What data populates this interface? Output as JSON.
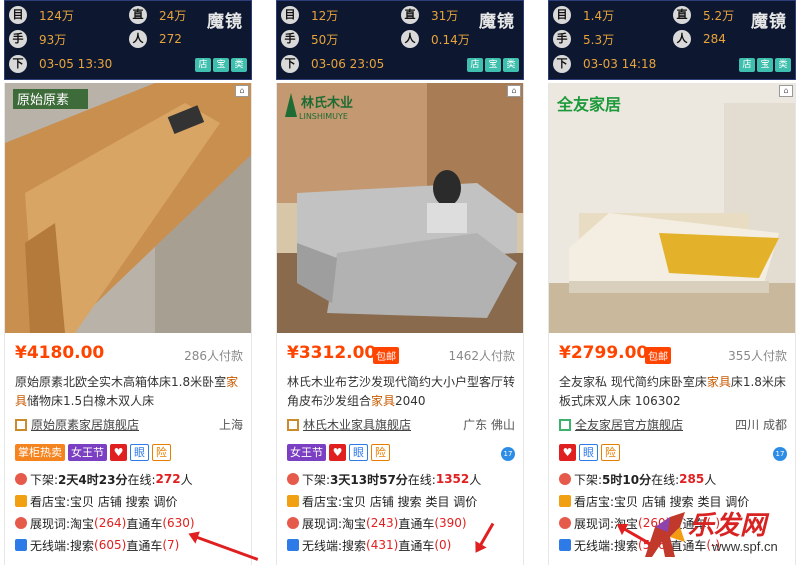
{
  "cards": [
    {
      "stats": {
        "icons": [
          "目",
          "直",
          "手",
          "人",
          "下"
        ],
        "r0a": "124万",
        "r0b": "24万",
        "r1a": "93万",
        "r1b": "272",
        "r2": "03-05 13:30"
      },
      "brand_overlay": "魔镜",
      "badge_labels": [
        "店",
        "宝",
        "类"
      ],
      "logo_text": "原始原素",
      "price": "¥4180.00",
      "baoyou": "",
      "sold": "286人付款",
      "title_pre": "原始原素北欧全实木高箱体床1.8米卧室",
      "title_kw": "家具",
      "title_post": "储物床1.5白橡木双人床",
      "shop": "原始原素家居旗舰店",
      "location": "上海",
      "tags": [
        "掌柜热卖",
        "女王节",
        "",
        "眼",
        "险"
      ],
      "offshelf": {
        "label": "下架:",
        "time": "2天4时23分",
        "online_label": " 在线:",
        "online": "272",
        "unit": "人"
      },
      "line1": "看店宝:宝贝 店铺 搜索 调价",
      "line2": {
        "label": "展现词:淘宝",
        "a": "(264)",
        "mid": " 直通车",
        "b": "(630)"
      },
      "line3": {
        "label": "无线端:搜索",
        "a": "(605)",
        "mid": " 直通车",
        "b": "(7)"
      }
    },
    {
      "stats": {
        "icons": [
          "目",
          "直",
          "手",
          "人",
          "下"
        ],
        "r0a": "12万",
        "r0b": "31万",
        "r1a": "50万",
        "r1b": "0.14万",
        "r2": "03-06 23:05"
      },
      "brand_overlay": "魔镜",
      "badge_labels": [
        "店",
        "宝",
        "类"
      ],
      "logo_text": "林氏木业",
      "logo_sub": "LINSHIMUYE",
      "price": "¥3312.00",
      "baoyou": "包邮",
      "sold": "1462人付款",
      "title_pre": "林氏木业布艺沙发现代简约大小户型客厅转角皮布沙发组合",
      "title_kw": "家具",
      "title_post": "2040",
      "shop": "林氏木业家具旗舰店",
      "location": "广东 佛山",
      "tags": [
        "女王节",
        "",
        "眼",
        "险"
      ],
      "offshelf": {
        "label": "下架:",
        "time": "3天13时57分",
        "online_label": " 在线:",
        "online": "1352",
        "unit": "人"
      },
      "line1": "看店宝:宝贝 店铺 搜索 类目 调价",
      "line2": {
        "label": "展现词:淘宝",
        "a": "(243)",
        "mid": " 直通车",
        "b": "(390)"
      },
      "line3": {
        "label": "无线端:搜索",
        "a": "(431)",
        "mid": " 直通车",
        "b": "(0)"
      }
    },
    {
      "stats": {
        "icons": [
          "目",
          "直",
          "手",
          "人",
          "下"
        ],
        "r0a": "1.4万",
        "r0b": "5.2万",
        "r1a": "5.3万",
        "r1b": "284",
        "r2": "03-03 14:18"
      },
      "brand_overlay": "魔镜",
      "badge_labels": [
        "店",
        "宝",
        "类"
      ],
      "logo_text": "全友家居",
      "price": "¥2799.00",
      "baoyou": "包邮",
      "sold": "355人付款",
      "title_pre": "全友家私 现代简约床卧室床",
      "title_kw": "家具",
      "title_post": "床1.8米床板式床双人床 106302",
      "shop": "全友家居官方旗舰店",
      "location": "四川 成都",
      "tags": [
        "",
        "眼",
        "险"
      ],
      "offshelf": {
        "label": "下架:",
        "time": "5时10分",
        "online_label": " 在线:",
        "online": "285",
        "unit": "人"
      },
      "line1": "看店宝:宝贝 店铺 搜索 类目 调价",
      "line2": {
        "label": "展现词:淘宝",
        "a": "(260)",
        "mid": " 直通车",
        "b": "(-)"
      },
      "line3": {
        "label": "无线端:搜索",
        "a": "(516)",
        "mid": " 直通车",
        "b": "(-)"
      }
    }
  ],
  "watermark": {
    "text": "乐发网",
    "url": "www.spf.cn"
  }
}
